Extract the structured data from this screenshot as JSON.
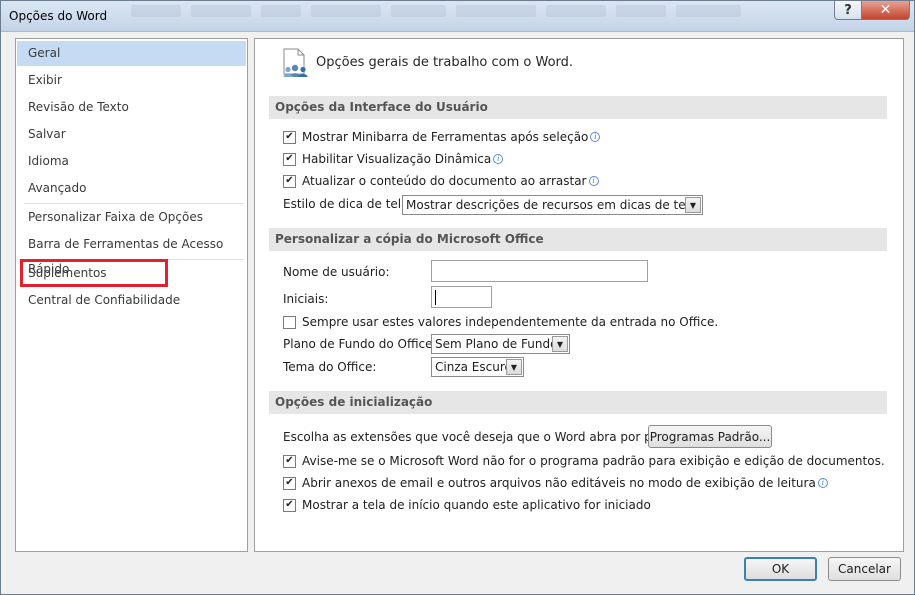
{
  "window": {
    "title": "Opções do Word"
  },
  "titlebar": {
    "help_label": "?",
    "close_label": "✕"
  },
  "nav": {
    "items": [
      {
        "label": "Geral"
      },
      {
        "label": "Exibir"
      },
      {
        "label": "Revisão de Texto"
      },
      {
        "label": "Salvar"
      },
      {
        "label": "Idioma"
      },
      {
        "label": "Avançado"
      },
      {
        "label": "Personalizar Faixa de Opções"
      },
      {
        "label": "Barra de Ferramentas de Acesso Rápido"
      },
      {
        "label": "Suplementos"
      },
      {
        "label": "Central de Confiabilidade"
      }
    ],
    "selected": "Geral",
    "highlighted": "Suplementos",
    "highlight_color": "#e2202f"
  },
  "content": {
    "heading": "Opções gerais de trabalho com o Word.",
    "sections": {
      "interface": {
        "title": "Opções da Interface do Usuário",
        "mini_toolbar": {
          "label": "Mostrar Minibarra de Ferramentas após seleção",
          "checked": true
        },
        "live_preview": {
          "label": "Habilitar Visualização Dinâmica",
          "checked": true
        },
        "update_drag": {
          "label": "Atualizar o conteúdo do documento ao arrastar",
          "checked": true
        },
        "screentip_label": "Estilo de dica de tela:",
        "screentip_value": "Mostrar descrições de recursos em dicas de tela"
      },
      "personalize": {
        "title": "Personalizar a cópia do Microsoft Office",
        "username_label": "Nome de usuário:",
        "username_value": "",
        "initials_label": "Iniciais:",
        "initials_value": "",
        "always_use": {
          "label": "Sempre usar estes valores independentemente da entrada no Office.",
          "checked": false
        },
        "background_label": "Plano de Fundo do Office:",
        "background_value": "Sem Plano de Fundo",
        "theme_label": "Tema do Office:",
        "theme_value": "Cinza Escuro"
      },
      "startup": {
        "title": "Opções de inicialização",
        "extensions_label": "Escolha as extensões que você deseja que o Word abra por padrão:",
        "default_programs_button": "Programas Padrão...",
        "notify_default": {
          "label": "Avise-me se o Microsoft Word não for o programa padrão para exibição e edição de documentos.",
          "checked": true
        },
        "open_attachments": {
          "label": "Abrir anexos de email e outros arquivos não editáveis no modo de exibição de leitura",
          "checked": true
        },
        "show_start": {
          "label": "Mostrar a tela de início quando este aplicativo for iniciado",
          "checked": true
        }
      }
    }
  },
  "footer": {
    "ok_label": "OK",
    "cancel_label": "Cancelar"
  }
}
